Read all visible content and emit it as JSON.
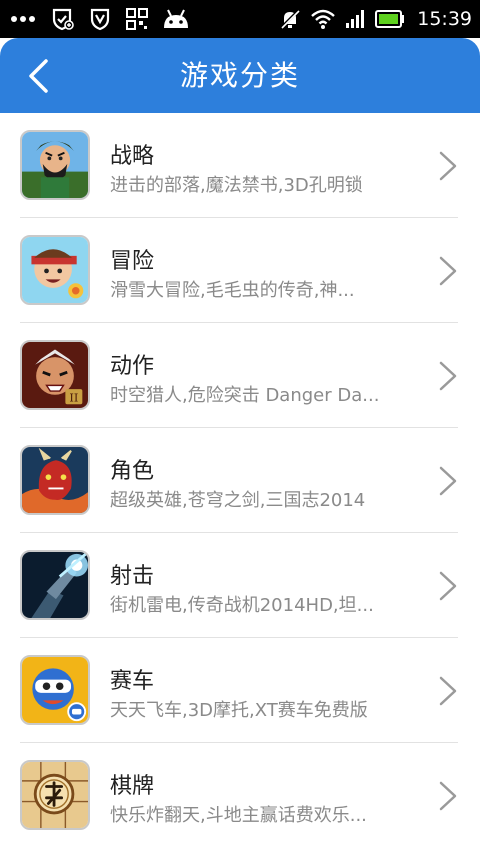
{
  "status_bar": {
    "time": "15:39",
    "icons": [
      "more-dots-icon",
      "shield-plus-icon",
      "shield-v-icon",
      "qr-grid-icon",
      "android-icon",
      "bell-muted-icon",
      "wifi-icon",
      "signal-icon",
      "battery-icon"
    ]
  },
  "header": {
    "title": "游戏分类",
    "back_icon": "chevron-left-icon"
  },
  "categories": [
    {
      "title": "战略",
      "desc": "进击的部落,魔法禁书,3D孔明锁"
    },
    {
      "title": "冒险",
      "desc": "滑雪大冒险,毛毛虫的传奇,神..."
    },
    {
      "title": "动作",
      "desc": "时空猎人,危险突击 Danger Da..."
    },
    {
      "title": "角色",
      "desc": "超级英雄,苍穹之剑,三国志2014"
    },
    {
      "title": "射击",
      "desc": "街机雷电,传奇战机2014HD,坦..."
    },
    {
      "title": "赛车",
      "desc": "天天飞车,3D摩托,XT赛车免费版"
    },
    {
      "title": "棋牌",
      "desc": "快乐炸翻天,斗地主赢话费欢乐..."
    }
  ],
  "colors": {
    "header_bg": "#2d7fdc",
    "title_text": "#222222",
    "desc_text": "#8a8a8a",
    "battery": "#5ed11e"
  }
}
